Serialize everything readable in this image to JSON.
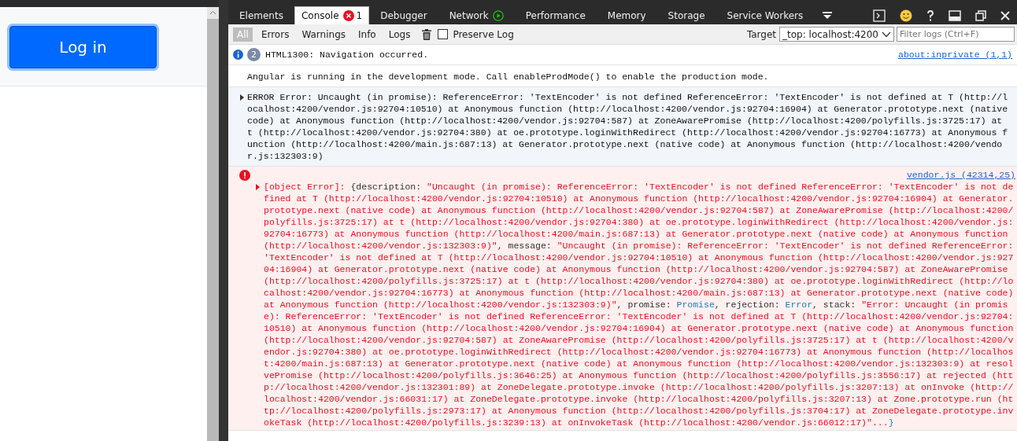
{
  "page": {
    "login_button": "Log in"
  },
  "devtools": {
    "tabs": [
      {
        "label": "Elements",
        "selected": false,
        "kind": "plain"
      },
      {
        "label": "Console",
        "selected": true,
        "kind": "errors",
        "badge": "1"
      },
      {
        "label": "Debugger",
        "selected": false,
        "kind": "plain"
      },
      {
        "label": "Network",
        "selected": false,
        "kind": "record"
      },
      {
        "label": "Performance",
        "selected": false,
        "kind": "plain"
      },
      {
        "label": "Memory",
        "selected": false,
        "kind": "plain"
      },
      {
        "label": "Storage",
        "selected": false,
        "kind": "plain"
      },
      {
        "label": "Service Workers",
        "selected": false,
        "kind": "plain"
      }
    ],
    "filters": [
      {
        "label": "All",
        "selected": true
      },
      {
        "label": "Errors",
        "selected": false
      },
      {
        "label": "Warnings",
        "selected": false
      },
      {
        "label": "Info",
        "selected": false
      },
      {
        "label": "Logs",
        "selected": false
      }
    ],
    "preserve_log": {
      "label": "Preserve Log",
      "checked": false
    },
    "target": {
      "label": "Target",
      "value": "_top: localhost:4200"
    },
    "filter_field": {
      "placeholder": "Filter logs (Ctrl+F)"
    },
    "messages": [
      {
        "kind": "info",
        "count": "2",
        "text": "HTML1300: Navigation occurred.",
        "source": "about:inprivate (1,1)"
      },
      {
        "kind": "log",
        "text": "Angular is running in the development mode. Call enableProdMode() to enable the production mode."
      },
      {
        "kind": "error-log",
        "expanded": false,
        "text": "ERROR Error: Uncaught (in promise): ReferenceError: 'TextEncoder' is not defined ReferenceError: 'TextEncoder' is not defined at T (http://localhost:4200/vendor.js:92704:10510) at Anonymous function (http://localhost:4200/vendor.js:92704:16904) at Generator.prototype.next (native code) at Anonymous function (http://localhost:4200/vendor.js:92704:587) at ZoneAwarePromise (http://localhost:4200/polyfills.js:3725:17) at t (http://localhost:4200/vendor.js:92704:380) at oe.prototype.loginWithRedirect (http://localhost:4200/vendor.js:92704:16773) at Anonymous function (http://localhost:4200/main.js:687:13) at Generator.prototype.next (native code) at Anonymous function (http://localhost:4200/vendor.js:132303:9)"
      },
      {
        "kind": "error-object",
        "expanded": false,
        "source": "vendor.js (42314,25)",
        "segments": [
          {
            "kind": "plain",
            "text": "[object Error]: "
          },
          {
            "kind": "key",
            "text": "{description: "
          },
          {
            "kind": "plain",
            "text": "\"Uncaught (in promise): ReferenceError: 'TextEncoder' is not defined ReferenceError: 'TextEncoder' is not defined at T (http://localhost:4200/vendor.js:92704:10510) at Anonymous function (http://localhost:4200/vendor.js:92704:16904) at Generator.prototype.next (native code) at Anonymous function (http://localhost:4200/vendor.js:92704:587) at ZoneAwarePromise (http://localhost:4200/polyfills.js:3725:17) at t (http://localhost:4200/vendor.js:92704:380) at oe.prototype.loginWithRedirect (http://localhost:4200/vendor.js:92704:16773) at Anonymous function (http://localhost:4200/main.js:687:13) at Generator.prototype.next (native code) at Anonymous function (http://localhost:4200/vendor.js:132303:9)\""
          },
          {
            "kind": "key",
            "text": ", message: "
          },
          {
            "kind": "plain",
            "text": "\"Uncaught (in promise): ReferenceError: 'TextEncoder' is not defined ReferenceError: 'TextEncoder' is not defined at T (http://localhost:4200/vendor.js:92704:10510) at Anonymous function (http://localhost:4200/vendor.js:92704:16904) at Generator.prototype.next (native code) at Anonymous function (http://localhost:4200/vendor.js:92704:587) at ZoneAwarePromise (http://localhost:4200/polyfills.js:3725:17) at t (http://localhost:4200/vendor.js:92704:380) at oe.prototype.loginWithRedirect (http://localhost:4200/vendor.js:92704:16773) at Anonymous function (http://localhost:4200/main.js:687:13) at Generator.prototype.next (native code) at Anonymous function (http://localhost:4200/vendor.js:132303:9)\""
          },
          {
            "kind": "key",
            "text": ", promise: "
          },
          {
            "kind": "ref",
            "text": "Promise"
          },
          {
            "kind": "key",
            "text": ", rejection: "
          },
          {
            "kind": "ref",
            "text": "Error"
          },
          {
            "kind": "key",
            "text": ", stack: "
          },
          {
            "kind": "plain",
            "text": "\"Error: Uncaught (in promise): ReferenceError: 'TextEncoder' is not defined ReferenceError: 'TextEncoder' is not defined at T (http://localhost:4200/vendor.js:92704:10510) at Anonymous function (http://localhost:4200/vendor.js:92704:16904) at Generator.prototype.next (native code) at Anonymous function (http://localhost:4200/vendor.js:92704:587) at ZoneAwarePromise (http://localhost:4200/polyfills.js:3725:17) at t (http://localhost:4200/vendor.js:92704:380) at oe.prototype.loginWithRedirect (http://localhost:4200/vendor.js:92704:16773) at Anonymous function (http://localhost:4200/main.js:687:13) at Generator.prototype.next (native code) at Anonymous function (http://localhost:4200/vendor.js:132303:9) at resolvePromise (http://localhost:4200/polyfills.js:3646:25) at Anonymous function (http://localhost:4200/polyfills.js:3556:17) at rejected (http://localhost:4200/vendor.js:132301:89) at ZoneDelegate.prototype.invoke (http://localhost:4200/polyfills.js:3207:13) at onInvoke (http://localhost:4200/vendor.js:66031:17) at ZoneDelegate.prototype.invoke (http://localhost:4200/polyfills.js:3207:13) at Zone.prototype.run (http://localhost:4200/polyfills.js:2973:17) at Anonymous function (http://localhost:4200/polyfills.js:3704:17) at ZoneDelegate.prototype.invokeTask (http://localhost:4200/polyfills.js:3239:13) at onInvokeTask (http://localhost:4200/vendor.js:66012:17)\"..."
          },
          {
            "kind": "ref",
            "text": "}"
          }
        ]
      }
    ]
  }
}
